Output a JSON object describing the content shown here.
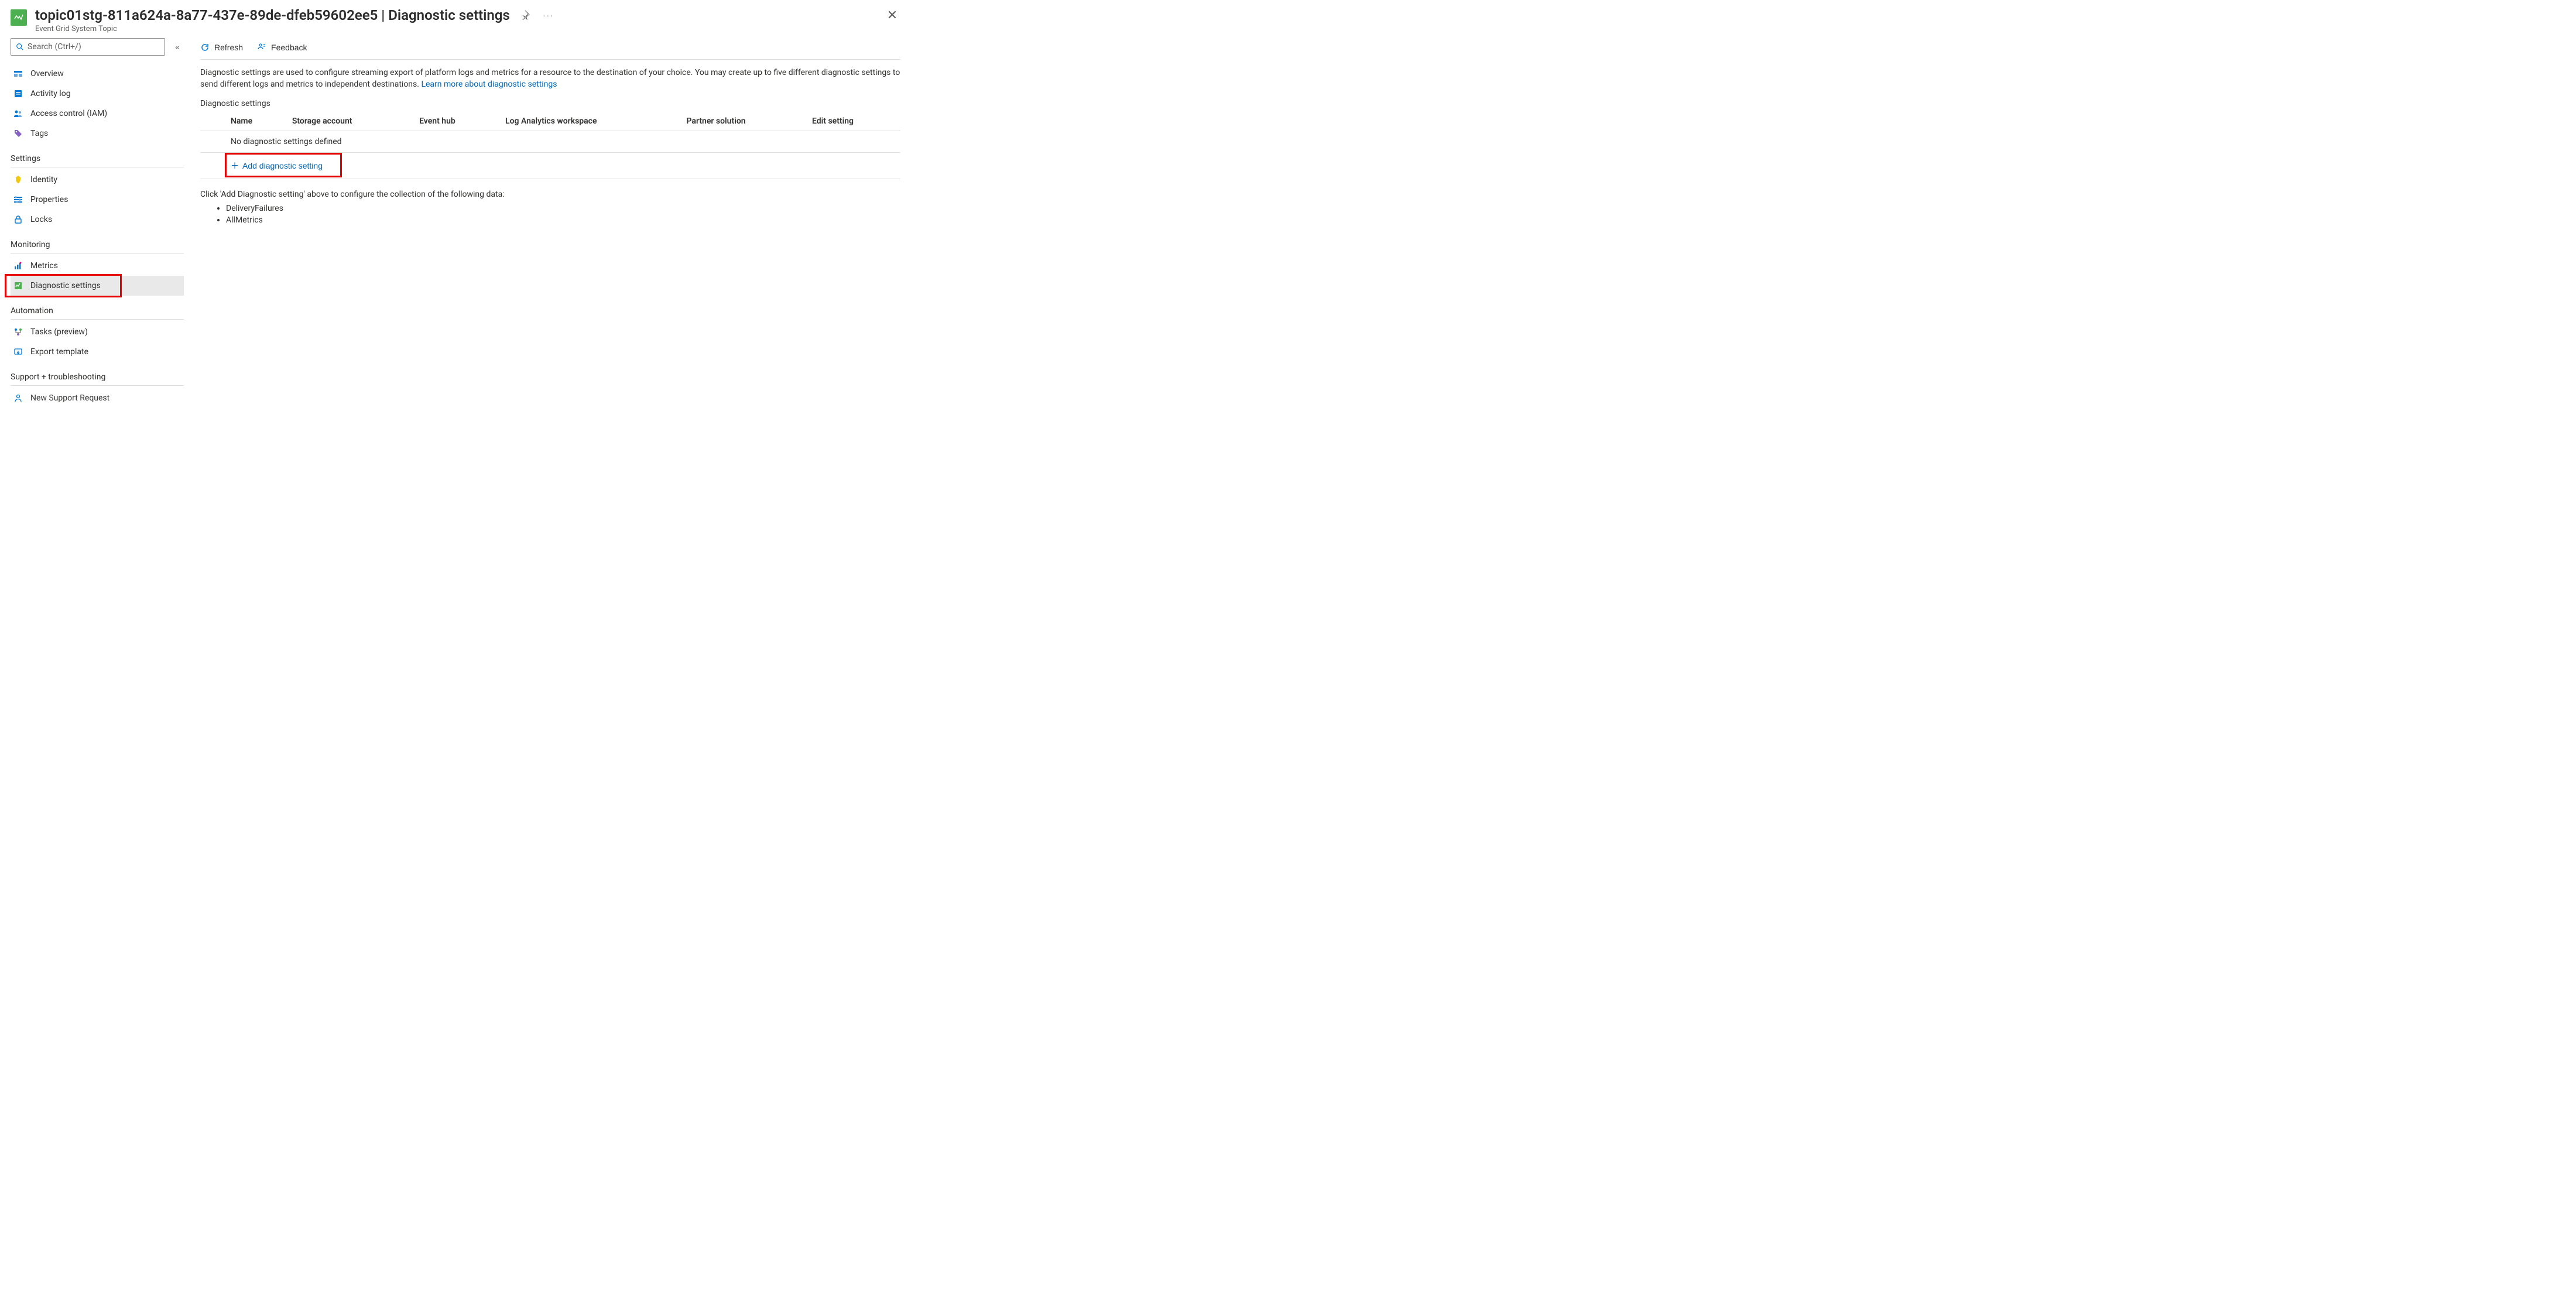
{
  "header": {
    "title": "topic01stg-811a624a-8a77-437e-89de-dfeb59602ee5 | Diagnostic settings",
    "subtitle": "Event Grid System Topic"
  },
  "search": {
    "placeholder": "Search (Ctrl+/)"
  },
  "nav": {
    "overview": "Overview",
    "activity": "Activity log",
    "access": "Access control (IAM)",
    "tags": "Tags",
    "settings_head": "Settings",
    "identity": "Identity",
    "properties": "Properties",
    "locks": "Locks",
    "monitoring_head": "Monitoring",
    "metrics": "Metrics",
    "diag": "Diagnostic settings",
    "automation_head": "Automation",
    "tasks": "Tasks (preview)",
    "export": "Export template",
    "support_head": "Support + troubleshooting",
    "support_req": "New Support Request"
  },
  "toolbar": {
    "refresh": "Refresh",
    "feedback": "Feedback"
  },
  "intro": {
    "text": "Diagnostic settings are used to configure streaming export of platform logs and metrics for a resource to the destination of your choice. You may create up to five different diagnostic settings to send different logs and metrics to independent destinations. ",
    "link": "Learn more about diagnostic settings"
  },
  "table": {
    "section_label": "Diagnostic settings",
    "cols": {
      "name": "Name",
      "storage": "Storage account",
      "eventhub": "Event hub",
      "law": "Log Analytics workspace",
      "partner": "Partner solution",
      "edit": "Edit setting"
    },
    "empty": "No diagnostic settings defined",
    "add": "Add diagnostic setting"
  },
  "hint": {
    "text": "Click 'Add Diagnostic setting' above to configure the collection of the following data:",
    "items": [
      "DeliveryFailures",
      "AllMetrics"
    ]
  }
}
